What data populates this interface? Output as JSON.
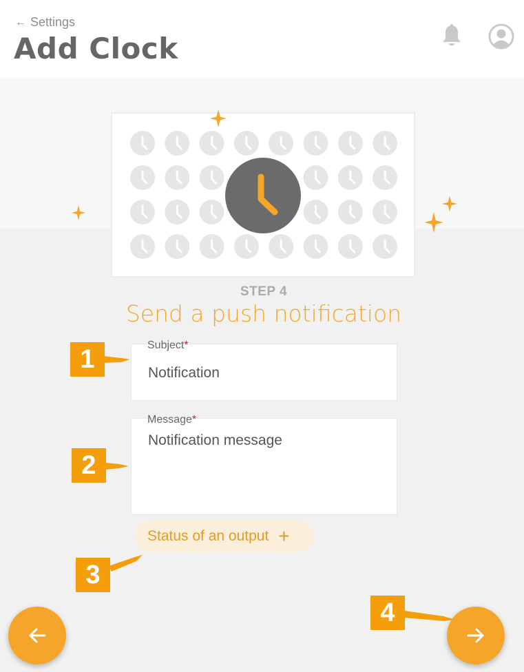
{
  "header": {
    "back_label": "Settings",
    "title": "Add Clock",
    "icons": [
      "arrow-left-icon",
      "bell-icon",
      "user-avatar-icon"
    ]
  },
  "wizard": {
    "step_label": "STEP 4",
    "step_title": "Send a push notification"
  },
  "form": {
    "subject": {
      "label": "Subject",
      "required_mark": "*",
      "value": "Notification"
    },
    "message": {
      "label": "Message",
      "required_mark": "*",
      "value": "Notification message"
    },
    "add_chip": {
      "label": "Status of an output",
      "icon": "plus-icon"
    }
  },
  "callouts": [
    "1",
    "2",
    "3",
    "4"
  ],
  "navigation": {
    "prev_icon": "arrow-left-icon",
    "next_icon": "arrow-right-icon"
  },
  "colors": {
    "accent": "#f5a62a",
    "callout": "#f59e0b",
    "required": "#c0202a",
    "clock_face": "#6b6b6b",
    "chip_bg": "#fbeedb"
  }
}
